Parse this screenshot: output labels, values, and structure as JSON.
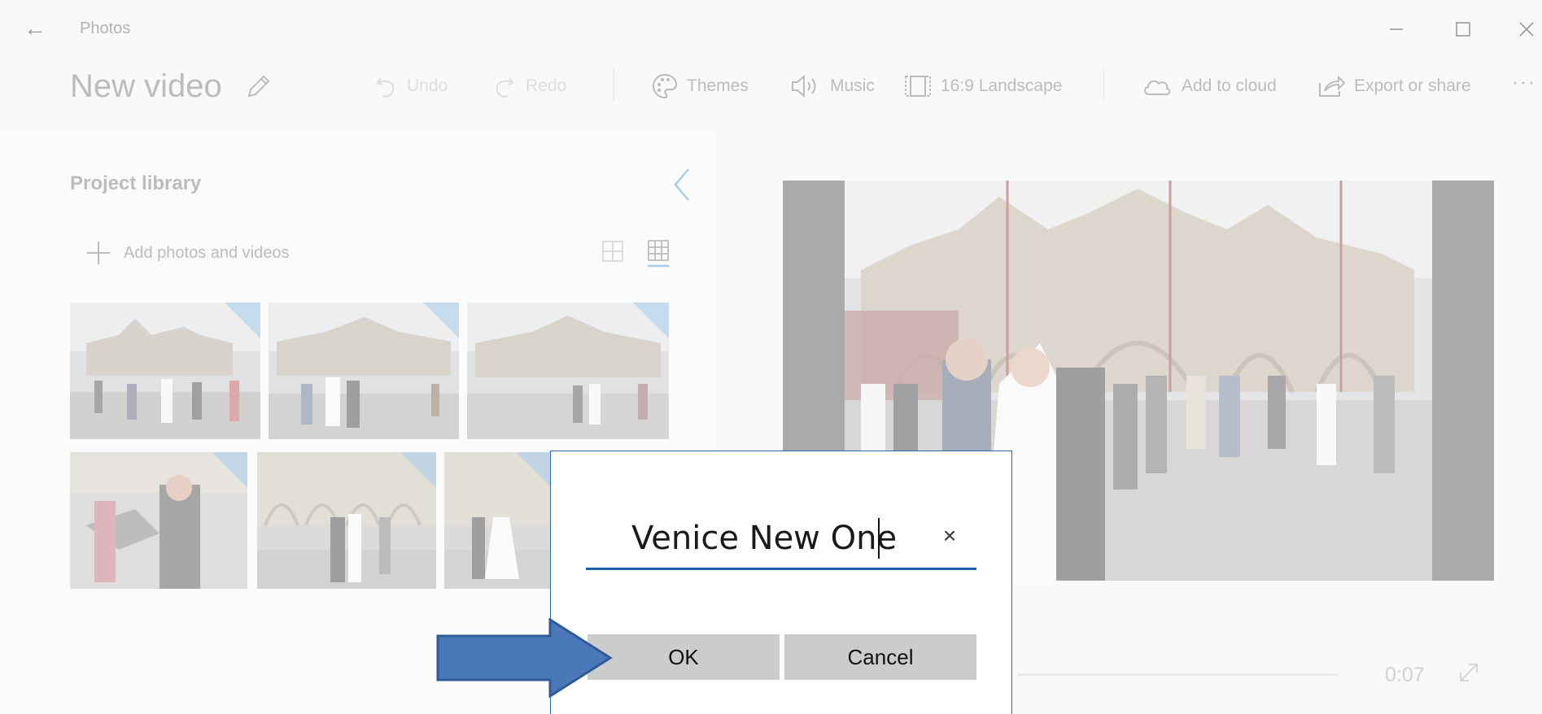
{
  "window": {
    "app_title": "Photos",
    "back_icon": "arrow-left-icon",
    "minimize_icon": "minimize-icon",
    "maximize_icon": "maximize-icon",
    "close_icon": "close-icon"
  },
  "toolbar": {
    "project_title": "New video",
    "undo_label": "Undo",
    "redo_label": "Redo",
    "themes_label": "Themes",
    "music_label": "Music",
    "aspect_label": "16:9 Landscape",
    "cloud_label": "Add to cloud",
    "export_label": "Export or share",
    "more_label": "···"
  },
  "library": {
    "title": "Project library",
    "add_label": "Add photos and videos"
  },
  "preview": {
    "time": "0:07"
  },
  "dialog": {
    "name_value": "Venice New One",
    "clear_label": "×",
    "ok_label": "OK",
    "cancel_label": "Cancel"
  },
  "colors": {
    "accent": "#1a5fa8",
    "arrow_fill": "#4a78b8",
    "arrow_stroke": "#2f5a96",
    "thumb_badge": "#3a8fd6"
  }
}
